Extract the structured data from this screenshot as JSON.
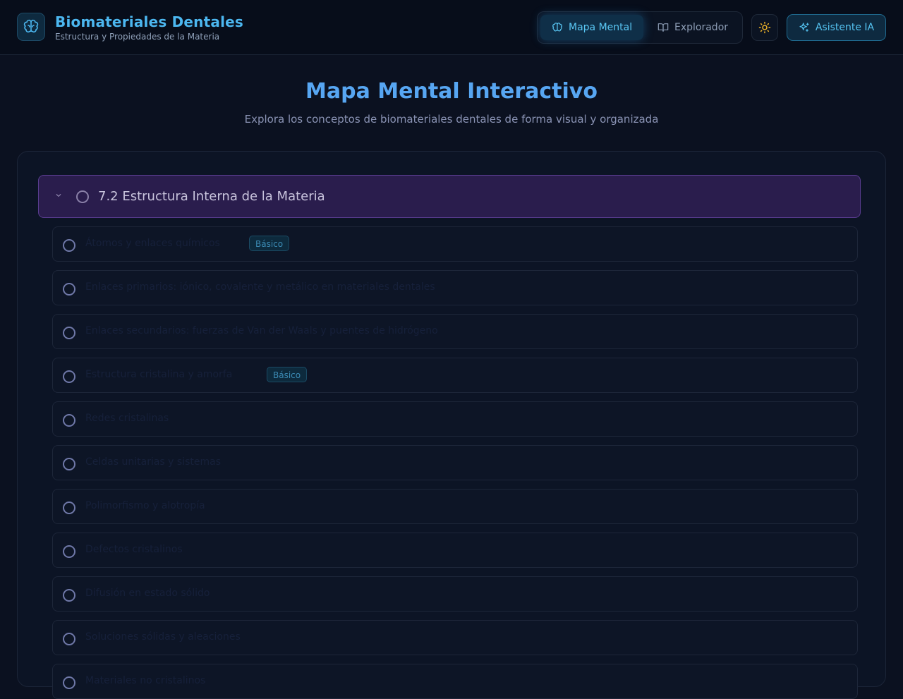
{
  "header": {
    "app_title": "Biomateriales Dentales",
    "app_subtitle": "Estructura y Propiedades de la Materia",
    "nav": [
      {
        "label": "Mapa Mental",
        "icon": "brain-icon",
        "active": true
      },
      {
        "label": "Explorador",
        "icon": "book-icon",
        "active": false
      }
    ],
    "theme_icon": "sun-icon",
    "ai_button_label": "Asistente IA",
    "ai_icon": "sparkles-icon"
  },
  "main": {
    "title": "Mapa Mental Interactivo",
    "subtitle": "Explora los conceptos de biomateriales dentales de forma visual y organizada"
  },
  "mind_map": {
    "root": {
      "label": "7.2 Estructura Interna de la Materia",
      "expanded": true
    },
    "children": [
      {
        "label": "Átomos y enlaces químicos",
        "badge": "Básico"
      },
      {
        "label": "Enlaces primarios: iónico, covalente y metálico en materiales dentales",
        "badge": ""
      },
      {
        "label": "Enlaces secundarios: fuerzas de Van der Waals y puentes de hidrógeno",
        "badge": ""
      },
      {
        "label": "Estructura cristalina y amorfa",
        "badge": "Básico"
      },
      {
        "label": "Redes cristalinas",
        "badge": ""
      },
      {
        "label": "Celdas unitarias y sistemas",
        "badge": ""
      },
      {
        "label": "Polimorfismo y alotropía",
        "badge": ""
      },
      {
        "label": "Defectos cristalinos",
        "badge": ""
      },
      {
        "label": "Difusión en estado sólido",
        "badge": ""
      },
      {
        "label": "Soluciones sólidas y aleaciones",
        "badge": ""
      },
      {
        "label": "Materiales no cristalinos",
        "badge": ""
      }
    ]
  },
  "colors": {
    "background": "#0b1120",
    "accent": "#4cb7f0",
    "title": "#57a6f2",
    "root_node": "#2a1d4d",
    "badge_text": "#3b8ab4"
  }
}
